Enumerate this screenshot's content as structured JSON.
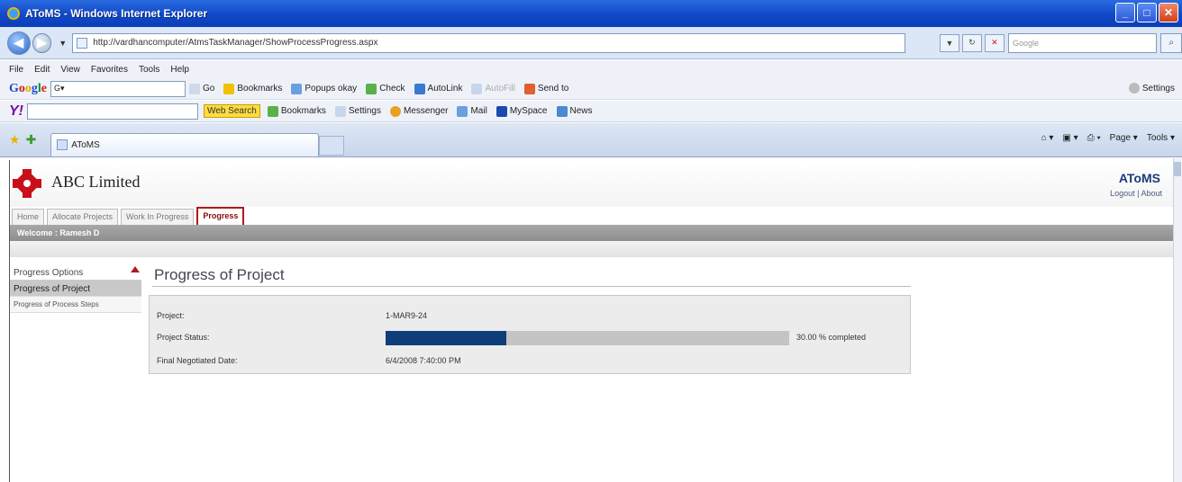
{
  "window": {
    "title": "AToMS - Windows Internet Explorer",
    "url": "http://vardhancomputer/AtmsTaskManager/ShowProcessProgress.aspx",
    "search_placeholder": "Google"
  },
  "menu": [
    "File",
    "Edit",
    "View",
    "Favorites",
    "Tools",
    "Help"
  ],
  "google_toolbar": {
    "items": [
      "Go",
      "Bookmarks",
      "Popups okay",
      "Check",
      "AutoLink",
      "AutoFill",
      "Send to"
    ],
    "settings": "Settings"
  },
  "yahoo_toolbar": {
    "logo": "Y!",
    "items": [
      "Web Search",
      "Bookmarks",
      "Settings",
      "Messenger",
      "Mail",
      "MySpace",
      "News"
    ]
  },
  "browser_tab": {
    "label": "AToMS",
    "commands": [
      "Page",
      "Tools"
    ]
  },
  "app": {
    "company": "ABC Limited",
    "name": "AToMS",
    "logout": "Logout",
    "about": "About",
    "tabs": [
      {
        "label": "Home",
        "active": false
      },
      {
        "label": "Allocate Projects",
        "active": false
      },
      {
        "label": "Work In Progress",
        "active": false
      },
      {
        "label": "Progress",
        "active": true
      }
    ],
    "welcome": "Welcome : Ramesh D"
  },
  "sidebar": {
    "items": [
      {
        "label": "Progress Options",
        "type": "header"
      },
      {
        "label": "Progress of Project",
        "type": "active"
      },
      {
        "label": "Progress of Process Steps",
        "type": "small"
      }
    ]
  },
  "content": {
    "title": "Progress of Project",
    "project_label": "Project:",
    "project_value": "1-MAR9-24",
    "status_label": "Project Status:",
    "progress_percent": 30,
    "progress_text": "30.00 % completed",
    "date_label": "Final Negotiated Date:",
    "date_value": "6/4/2008 7:40:00 PM"
  }
}
